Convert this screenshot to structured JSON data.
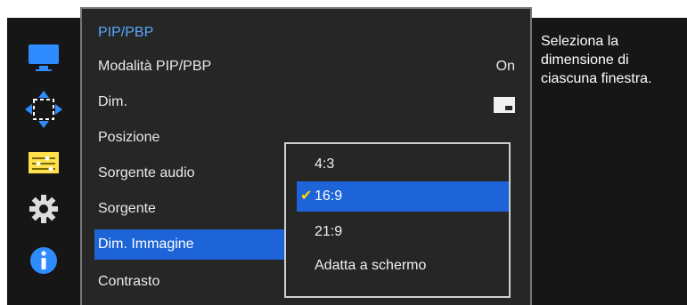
{
  "menu": {
    "title": "PIP/PBP",
    "items": [
      {
        "label": "Modalità PIP/PBP",
        "value": "On"
      },
      {
        "label": "Dim.",
        "value_icon": "window-size-icon"
      },
      {
        "label": "Posizione"
      },
      {
        "label": "Sorgente audio"
      },
      {
        "label": "Sorgente"
      },
      {
        "label": "Dim. Immagine",
        "selected": true
      },
      {
        "label": "Contrasto"
      }
    ]
  },
  "dropdown": {
    "options": [
      {
        "label": "4:3"
      },
      {
        "label": "16:9",
        "selected": true
      },
      {
        "label": "21:9"
      },
      {
        "label": "Adatta a schermo"
      }
    ]
  },
  "help": {
    "text": "Seleziona la dimensione di ciascuna finestra."
  },
  "sidebar": {
    "icons": [
      "monitor-icon",
      "move-arrows-icon",
      "sliders-icon",
      "gear-icon",
      "info-icon"
    ]
  },
  "colors": {
    "accent": "#1c64d8",
    "title": "#56a9ff",
    "check": "#ffd400"
  }
}
